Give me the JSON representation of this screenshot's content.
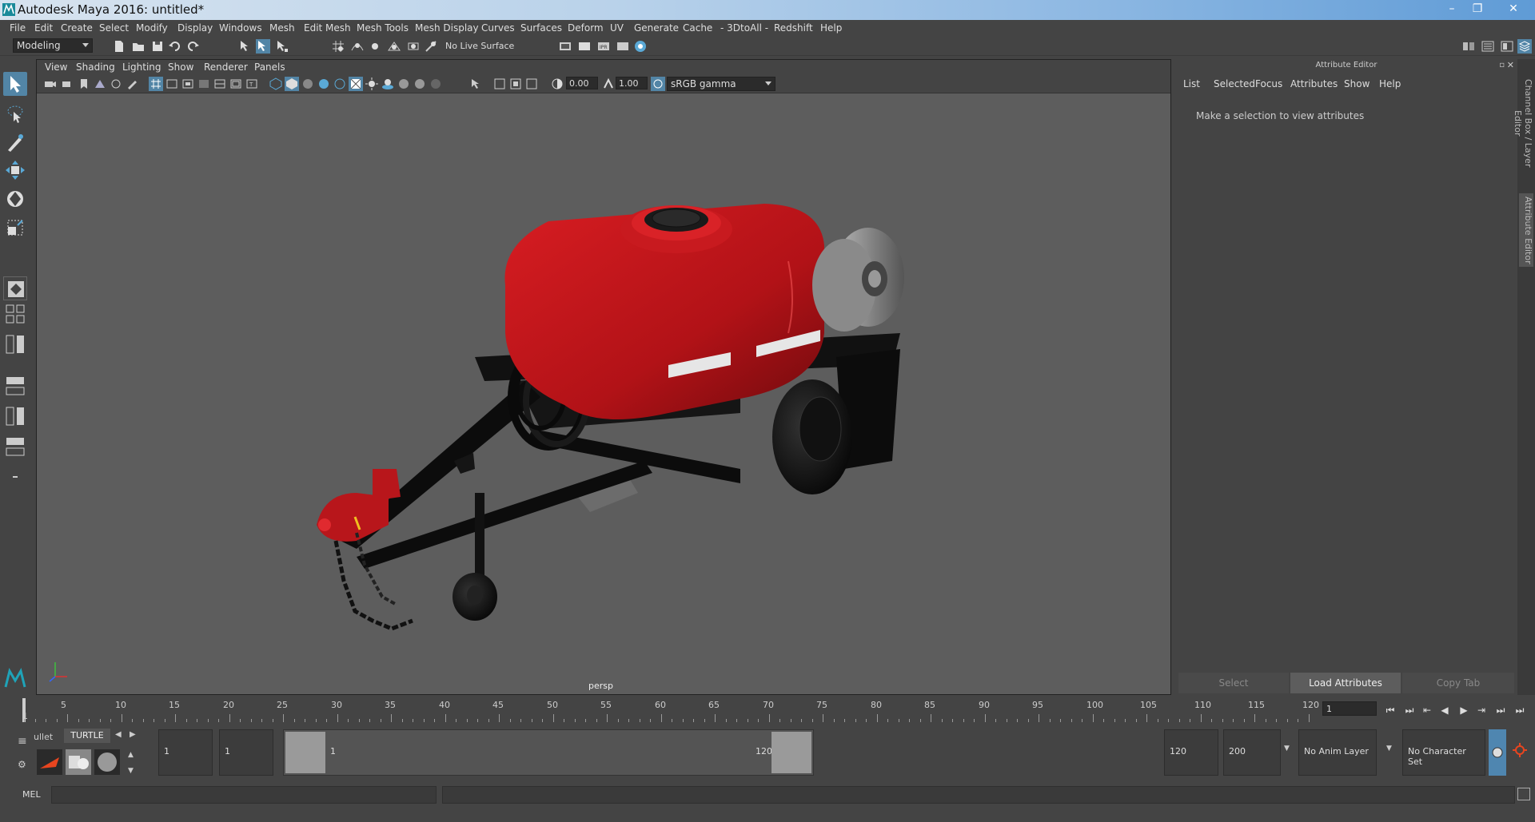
{
  "window": {
    "title": "Autodesk Maya 2016: untitled*",
    "controls": [
      "–",
      "❐",
      "✕"
    ]
  },
  "menubar": {
    "items": [
      "File",
      "Edit",
      "Create",
      "Select",
      "Modify",
      "Display",
      "Windows",
      "Mesh",
      "Edit Mesh",
      "Mesh Tools",
      "Mesh Display",
      "Curves",
      "Surfaces",
      "Deform",
      "UV",
      "Generate",
      "Cache",
      "- 3DtoAll -",
      "Redshift",
      "Help"
    ]
  },
  "statusline": {
    "menuset": "Modeling",
    "live_surface": "No Live Surface"
  },
  "viewport": {
    "menu": [
      "View",
      "Shading",
      "Lighting",
      "Show",
      "Renderer",
      "Panels"
    ],
    "exposure": "0.00",
    "gamma": "1.00",
    "colorspace": "sRGB gamma",
    "camera": "persp"
  },
  "attribute_editor": {
    "header": "Attribute Editor",
    "menu": [
      "List",
      "Selected",
      "Focus",
      "Attributes",
      "Show",
      "Help"
    ],
    "message": "Make a selection to view attributes",
    "buttons": {
      "select": "Select",
      "load": "Load Attributes",
      "copy": "Copy Tab"
    }
  },
  "sidetabs": {
    "channel_box": "Channel Box / Layer Editor",
    "attribute_editor": "Attribute Editor"
  },
  "timeslider": {
    "ticks": [
      "5",
      "10",
      "15",
      "20",
      "25",
      "30",
      "35",
      "40",
      "45",
      "50",
      "55",
      "60",
      "65",
      "70",
      "75",
      "80",
      "85",
      "90",
      "95",
      "100",
      "105",
      "110",
      "115",
      "120"
    ],
    "start_label": "1",
    "current_frame": "1"
  },
  "rangebar": {
    "shelf_tab_left": "ullet",
    "shelf_tab": "TURTLE",
    "start_time": "1",
    "playback_start": "1",
    "range_start_label": "1",
    "range_end_label": "120",
    "playback_end": "120",
    "end_time": "200",
    "anim_layer": "No Anim Layer",
    "character_set": "No Character Set"
  },
  "cmdline": {
    "label": "MEL"
  },
  "colors": {
    "accent": "#5285a6",
    "tank": "#c0151a",
    "frame": "#111111"
  }
}
